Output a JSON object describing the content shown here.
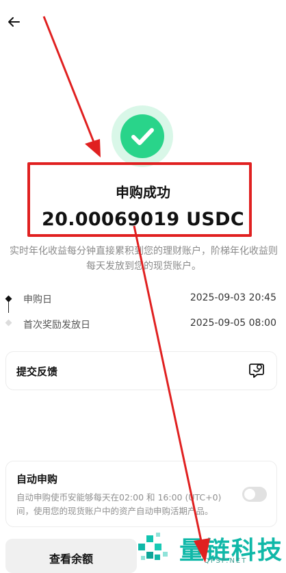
{
  "header": {
    "back_icon": "arrow-left-icon"
  },
  "status": {
    "icon": "check-circle-icon",
    "title": "申购成功",
    "amount": "20.00069019 USDC",
    "description": "实时年化收益每分钟直接累积到您的理财账户，阶梯年化收益则每天发放到您的现货账户。"
  },
  "timeline": [
    {
      "label": "申购日",
      "value": "2025-09-03 20:45"
    },
    {
      "label": "首次奖励发放日",
      "value": "2025-09-05 08:00"
    }
  ],
  "feedback": {
    "label": "提交反馈",
    "icon": "feedback-smile-icon"
  },
  "auto_subscribe": {
    "title": "自动申购",
    "description": "自动申购使币安能够每天在02:00 和 16:00 (UTC+0) 间，使用您的现货账户中的资产自动申购活期产品。",
    "enabled": false
  },
  "buttons": {
    "view_balance": "查看余额"
  },
  "watermark": {
    "text": "量链科技",
    "sub": "QFSP.NET"
  },
  "colors": {
    "success": "#29d48a",
    "highlight": "#e02020",
    "watermark": "#10b8a8"
  }
}
